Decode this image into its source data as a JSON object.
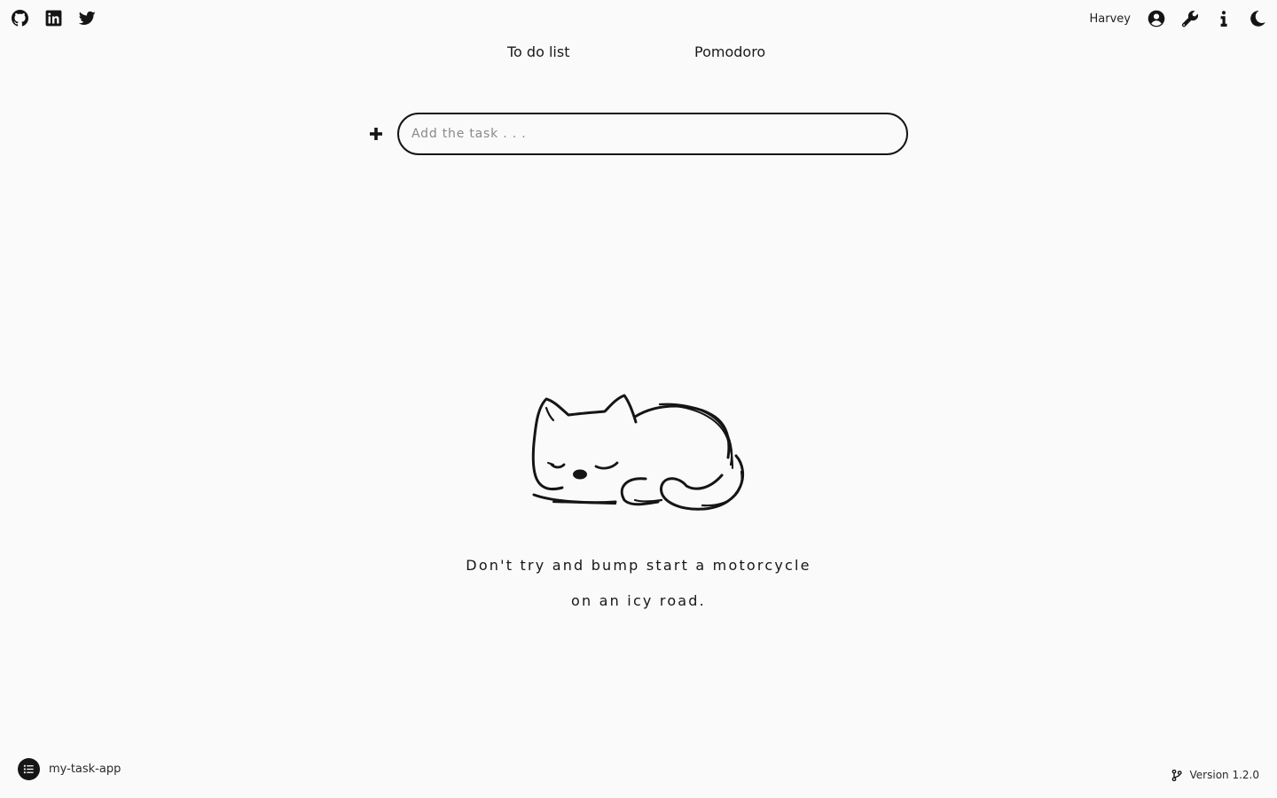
{
  "header": {
    "social_icons": [
      "github-icon",
      "linkedin-icon",
      "twitter-icon"
    ],
    "username": "Harvey",
    "action_icons": [
      "user-circle-icon",
      "wrench-icon",
      "info-icon",
      "moon-icon"
    ]
  },
  "tabs": [
    {
      "label": "To do list"
    },
    {
      "label": "Pomodoro"
    }
  ],
  "task_input": {
    "value": "",
    "placeholder": "Add the task . . ."
  },
  "empty_state": {
    "illustration": "sleeping-cat",
    "quote_lines": [
      "Don't try and bump start a motorcycle",
      "on an icy road."
    ]
  },
  "footer": {
    "app_name": "my-task-app",
    "version": "Version 1.2.0"
  },
  "colors": {
    "background": "#fafafa",
    "ink": "#151515"
  }
}
